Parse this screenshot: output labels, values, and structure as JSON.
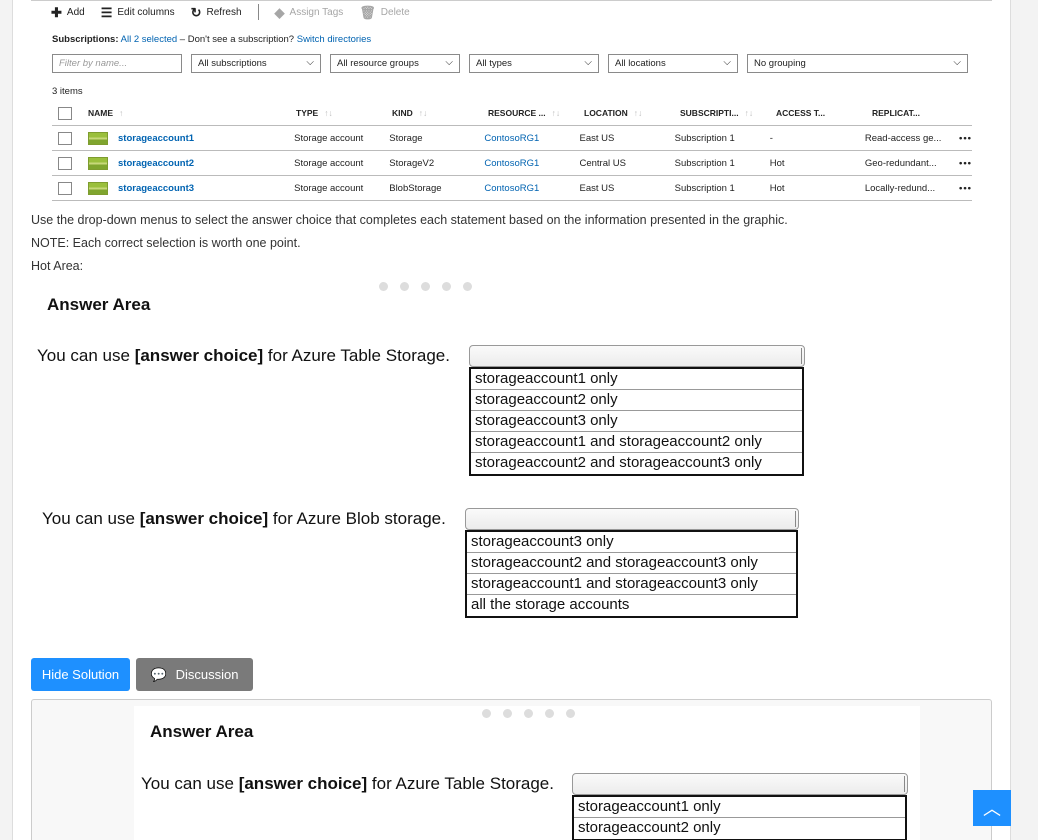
{
  "toolbar": {
    "add": "Add",
    "edit_columns": "Edit columns",
    "refresh": "Refresh",
    "assign_tags": "Assign Tags",
    "delete": "Delete"
  },
  "subscriptions": {
    "label": "Subscriptions:",
    "selected": "All 2 selected",
    "text": " – Don't see a subscription? ",
    "switch": "Switch directories"
  },
  "filters": {
    "name_placeholder": "Filter by name...",
    "subscriptions": "All subscriptions",
    "resource_groups": "All resource groups",
    "types": "All types",
    "locations": "All locations",
    "grouping": "No grouping"
  },
  "items_count": "3 items",
  "columns": [
    "NAME",
    "TYPE",
    "KIND",
    "RESOURCE ...",
    "LOCATION",
    "SUBSCRIPTI...",
    "ACCESS T...",
    "REPLICAT..."
  ],
  "rows": [
    {
      "name": "storageaccount1",
      "type": "Storage account",
      "kind": "Storage",
      "rg": "ContosoRG1",
      "location": "East US",
      "subscription": "Subscription 1",
      "access": "-",
      "replication": "Read-access ge..."
    },
    {
      "name": "storageaccount2",
      "type": "Storage account",
      "kind": "StorageV2",
      "rg": "ContosoRG1",
      "location": "Central US",
      "subscription": "Subscription 1",
      "access": "Hot",
      "replication": "Geo-redundant..."
    },
    {
      "name": "storageaccount3",
      "type": "Storage account",
      "kind": "BlobStorage",
      "rg": "ContosoRG1",
      "location": "East US",
      "subscription": "Subscription 1",
      "access": "Hot",
      "replication": "Locally-redund..."
    }
  ],
  "more_glyph": "•••",
  "instructions": {
    "line1": "Use the drop-down menus to select the answer choice that completes each statement based on the information presented in the graphic.",
    "line2": "NOTE: Each correct selection is worth one point.",
    "line3": "Hot Area:"
  },
  "answer_area": {
    "title": "Answer Area",
    "q1": {
      "prefix": "You can use ",
      "bold": "[answer choice]",
      "suffix": " for Azure Table Storage."
    },
    "q1_options": [
      "storageaccount1 only",
      "storageaccount2 only",
      "storageaccount3 only",
      "storageaccount1 and storageaccount2 only",
      "storageaccount2 and storageaccount3 only"
    ],
    "q2": {
      "prefix": "You can use ",
      "bold": "[answer choice]",
      "suffix": " for Azure Blob storage."
    },
    "q2_options": [
      "storageaccount3 only",
      "storageaccount2 and storageaccount3 only",
      "storageaccount1 and storageaccount3 only",
      "all the storage accounts"
    ]
  },
  "buttons": {
    "hide_solution": "Hide Solution",
    "discussion": "Discussion"
  },
  "icons": {
    "add": "plus-icon",
    "edit_columns": "columns-icon",
    "refresh": "refresh-icon",
    "assign_tags": "tag-icon",
    "delete": "trash-icon",
    "discussion": "comment-icon",
    "to_top": "chevron-up-icon"
  },
  "colors": {
    "link": "#0063b1",
    "primary_button": "#1e90ff",
    "secondary_button": "#7a7a7a"
  }
}
